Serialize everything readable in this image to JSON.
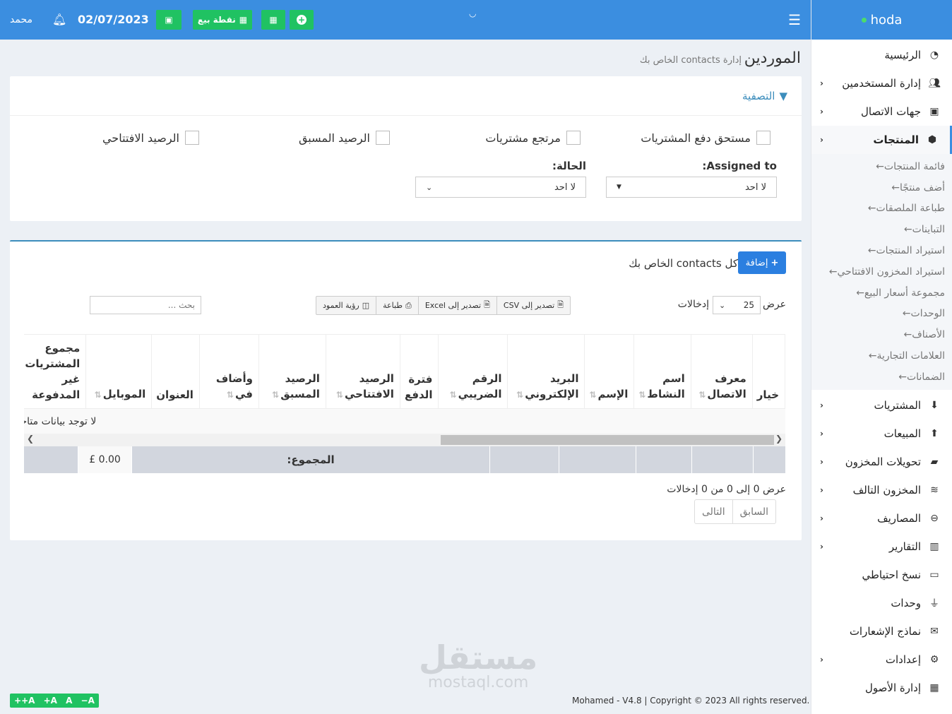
{
  "brand": "hoda",
  "topbar": {
    "user": "محمد",
    "date": "02/07/2023",
    "pos_label": "نقطة بيع"
  },
  "page": {
    "title": "الموردين",
    "subtitle": "إدارة contacts الخاص بك"
  },
  "filter": {
    "title": "التصفية",
    "checkboxes": [
      "مستحق دفع المشتريات",
      "مرتجع مشتريات",
      "الرصيد المسبق",
      "الرصيد الافتتاحي"
    ],
    "assigned_label": "Assigned to:",
    "assigned_value": "لا احد",
    "status_label": "الحالة:",
    "status_value": "لا احد"
  },
  "table_box": {
    "title": "كل contacts الخاص بك",
    "add_label": "إضافة",
    "show_label": "عرض",
    "entries_label": "إدخالات",
    "page_length": "25",
    "buttons": [
      "تصدير إلى CSV",
      "تصدير إلى Excel",
      "طباعة",
      "رؤية العمود"
    ],
    "search_placeholder": "بحث ...",
    "columns": [
      "خيار",
      "معرف الاتصال",
      "اسم النشاط",
      "الإسم",
      "البريد الإلكتروني",
      "الرقم الضريبي",
      "فترة الدفع",
      "الرصيد الافتتاحي",
      "الرصيد المسبق",
      "وأضاف في",
      "العنوان",
      "الموبايل",
      "مجموع المشتريات غير المدفوعة"
    ],
    "empty_text": "لا توجد بيانات متاحة",
    "total_label": "المجموع:",
    "total_value": "£ 0.00",
    "info": "عرض 0 إلى 0 من 0 إدخالات",
    "prev": "السابق",
    "next": "التالى"
  },
  "sidebar": {
    "items": [
      {
        "label": "الرئيسية",
        "icon": "gauge-icon"
      },
      {
        "label": "إدارة المستخدمين",
        "icon": "users-icon"
      },
      {
        "label": "جهات الاتصال",
        "icon": "address-book-icon"
      },
      {
        "label": "المنتجات",
        "icon": "cubes-icon"
      }
    ],
    "product_sub": [
      "فائمة المنتجات",
      "أضف منتجًا",
      "طباعة الملصقات",
      "التباينات",
      "استيراد المنتجات",
      "استيراد المخزون الافتتاحي",
      "مجموعة أسعار البيع",
      "الوحدات",
      "الأصناف",
      "العلامات التجارية",
      "الضمانات"
    ],
    "more_items": [
      {
        "label": "المشتريات",
        "icon": "arrow-down-circle-icon"
      },
      {
        "label": "المبيعات",
        "icon": "arrow-up-circle-icon"
      },
      {
        "label": "تحويلات المخزون",
        "icon": "truck-icon"
      },
      {
        "label": "المخزون التالف",
        "icon": "database-icon"
      },
      {
        "label": "المصاريف",
        "icon": "minus-circle-icon"
      },
      {
        "label": "التقارير",
        "icon": "bar-chart-icon"
      },
      {
        "label": "نسخ احتياطي",
        "icon": "hdd-icon"
      },
      {
        "label": "وحدات",
        "icon": "plug-icon"
      },
      {
        "label": "نماذج الإشعارات",
        "icon": "envelope-icon"
      },
      {
        "label": "إعدادات",
        "icon": "gear-icon"
      },
      {
        "label": "إدارة الأصول",
        "icon": "boxes-icon"
      }
    ]
  },
  "footer": {
    "copyright": "Mohamed - V4.8 | Copyright © 2023 All rights reserved.",
    "font_controls": "++A +A A −A"
  },
  "watermark": {
    "line1": "مستقل",
    "line2": "mostaql.com"
  },
  "colors": {
    "primary": "#3b8ee0",
    "success": "#20c262",
    "background": "#ecf0f5"
  }
}
